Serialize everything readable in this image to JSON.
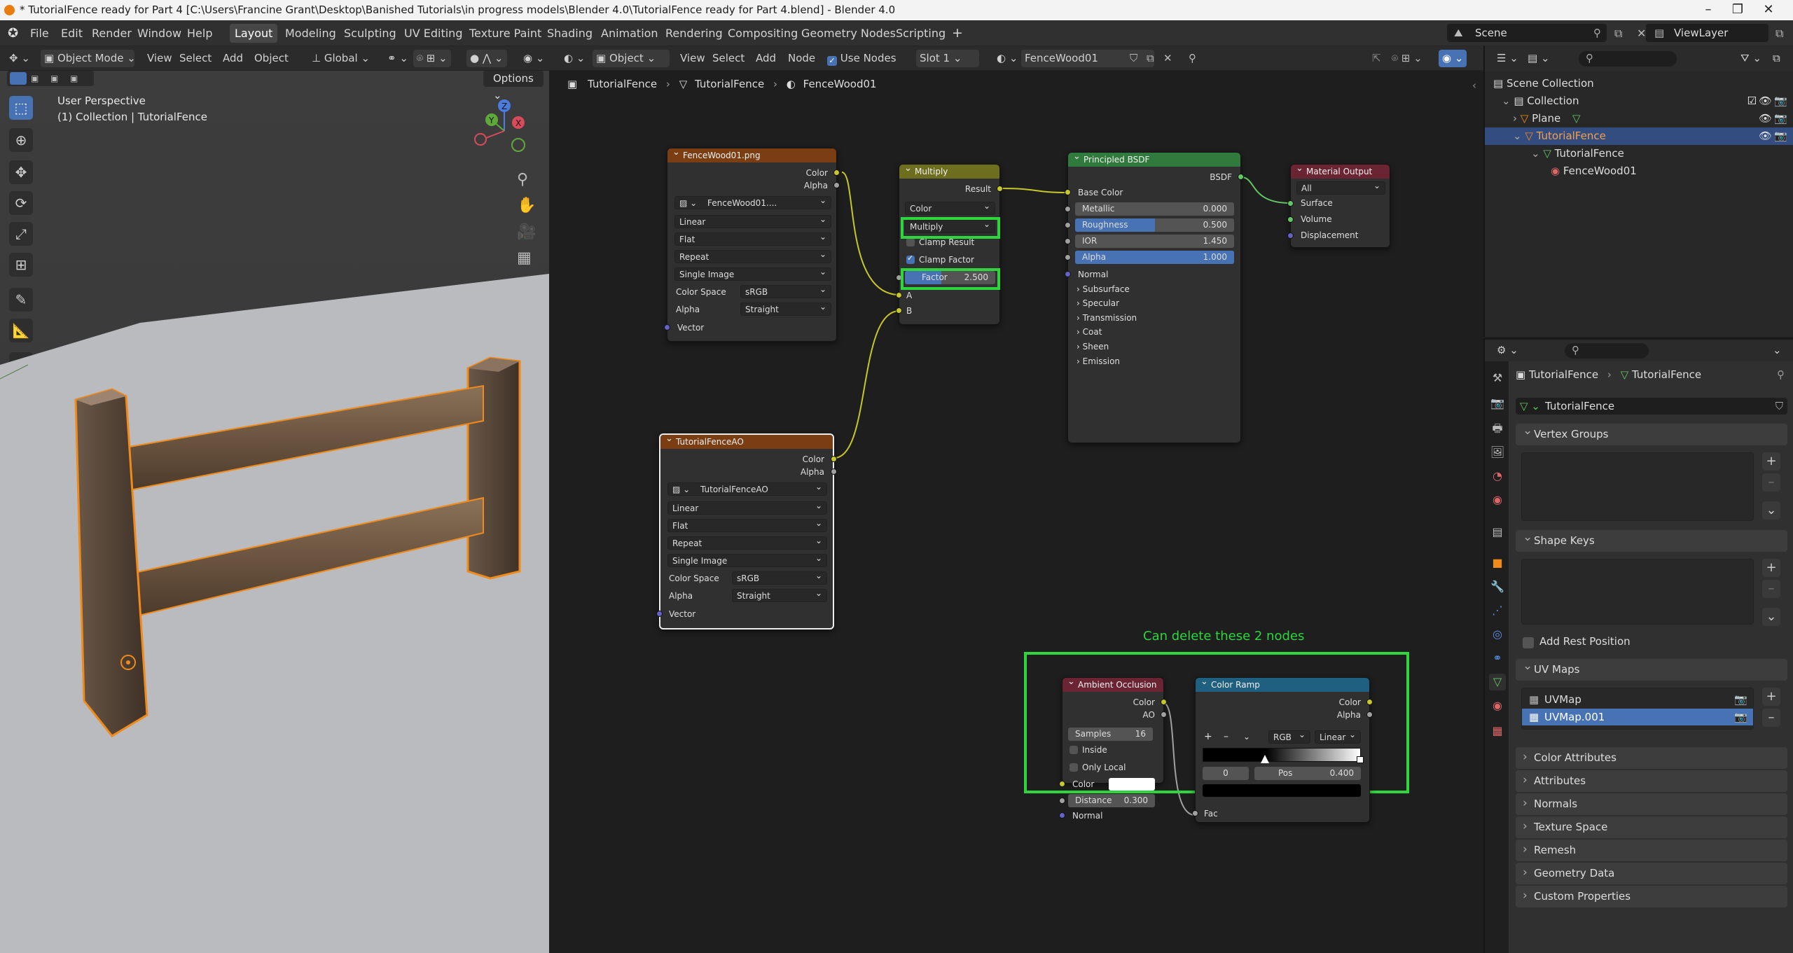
{
  "window": {
    "title": "* TutorialFence ready for Part 4 [C:\\Users\\Francine Grant\\Desktop\\Banished Tutorials\\in progress models\\Blender 4.0\\TutorialFence ready for Part 4.blend] - Blender 4.0"
  },
  "menu": [
    "File",
    "Edit",
    "Render",
    "Window",
    "Help"
  ],
  "workspaces": [
    "Layout",
    "Modeling",
    "Sculpting",
    "UV Editing",
    "Texture Paint",
    "Shading",
    "Animation",
    "Rendering",
    "Compositing",
    "Geometry Nodes",
    "Scripting"
  ],
  "active_workspace": "Layout",
  "scene": "Scene",
  "view_layer": "ViewLayer",
  "viewport": {
    "mode": "Object Mode",
    "menus": [
      "View",
      "Select",
      "Add",
      "Object"
    ],
    "orientation": "Global",
    "options": "Options",
    "overlay_line1": "User Perspective",
    "overlay_line2": "(1) Collection | TutorialFence",
    "gizmo": {
      "x": "X",
      "y": "Y",
      "z": "Z"
    }
  },
  "node_editor": {
    "type": "Object",
    "menus": [
      "View",
      "Select",
      "Add",
      "Node"
    ],
    "use_nodes": "Use Nodes",
    "slot": "Slot 1",
    "material": "FenceWood01",
    "breadcrumb": [
      "TutorialFence",
      "TutorialFence",
      "FenceWood01"
    ],
    "annotation": "Can delete these 2 nodes",
    "nodes": {
      "fence_tex": {
        "title": "FenceWood01.png",
        "out_color": "Color",
        "out_alpha": "Alpha",
        "image": "FenceWood01....",
        "interp": "Linear",
        "proj": "Flat",
        "ext": "Repeat",
        "source": "Single Image",
        "cs_label": "Color Space",
        "cs_value": "sRGB",
        "alpha_label": "Alpha",
        "alpha_value": "Straight",
        "in_vector": "Vector"
      },
      "ao_tex": {
        "title": "TutorialFenceAO",
        "out_color": "Color",
        "out_alpha": "Alpha",
        "image": "TutorialFenceAO",
        "interp": "Linear",
        "proj": "Flat",
        "ext": "Repeat",
        "source": "Single Image",
        "cs_label": "Color Space",
        "cs_value": "sRGB",
        "alpha_label": "Alpha",
        "alpha_value": "Straight",
        "in_vector": "Vector"
      },
      "multiply": {
        "title": "Multiply",
        "out": "Result",
        "data_type": "Color",
        "blend": "Multiply",
        "clamp_result": "Clamp Result",
        "clamp_factor": "Clamp Factor",
        "factor_label": "Factor",
        "factor_value": "2.500",
        "in_a": "A",
        "in_b": "B"
      },
      "bsdf": {
        "title": "Principled BSDF",
        "out": "BSDF",
        "base_color": "Base Color",
        "metallic_label": "Metallic",
        "metallic_value": "0.000",
        "metallic_fill": 0.0,
        "roughness_label": "Roughness",
        "roughness_value": "0.500",
        "roughness_fill": 0.5,
        "ior_label": "IOR",
        "ior_value": "1.450",
        "alpha_label": "Alpha",
        "alpha_value": "1.000",
        "alpha_fill": 1.0,
        "normal": "Normal",
        "sections": [
          "Subsurface",
          "Specular",
          "Transmission",
          "Coat",
          "Sheen",
          "Emission"
        ]
      },
      "output": {
        "title": "Material Output",
        "target": "All",
        "surface": "Surface",
        "volume": "Volume",
        "displacement": "Displacement"
      },
      "ao": {
        "title": "Ambient Occlusion",
        "out_color": "Color",
        "out_ao": "AO",
        "samples_label": "Samples",
        "samples_value": "16",
        "inside": "Inside",
        "only_local": "Only Local",
        "in_color": "Color",
        "distance_label": "Distance",
        "distance_value": "0.300",
        "in_normal": "Normal"
      },
      "ramp": {
        "title": "Color Ramp",
        "out_color": "Color",
        "out_alpha": "Alpha",
        "mode": "RGB",
        "interp": "Linear",
        "index": "0",
        "pos_label": "Pos",
        "pos_value": "0.400",
        "in_fac": "Fac"
      }
    }
  },
  "outliner": {
    "scene_collection": "Scene Collection",
    "items": [
      {
        "label": "Collection"
      },
      {
        "label": "Plane"
      },
      {
        "label": "TutorialFence"
      },
      {
        "label": "TutorialFence"
      },
      {
        "label": "FenceWood01"
      }
    ]
  },
  "properties": {
    "breadcrumb": [
      "TutorialFence",
      "TutorialFence"
    ],
    "mesh_name": "TutorialFence",
    "panels": {
      "vertex_groups": "Vertex Groups",
      "shape_keys": "Shape Keys",
      "add_rest_position": "Add Rest Position",
      "uv_maps": "UV Maps",
      "uv_items": [
        "UVMap",
        "UVMap.001"
      ],
      "closed": [
        "Color Attributes",
        "Attributes",
        "Normals",
        "Texture Space",
        "Remesh",
        "Geometry Data",
        "Custom Properties"
      ]
    }
  },
  "colors": {
    "accent": "#4772b3",
    "selection_orange": "#f08a1a",
    "highlight_green": "#2cd63c",
    "tex_header": "#7b3e13",
    "mix_header": "#6e6e1f",
    "shader_header": "#2f7a3c",
    "output_header": "#6b2431",
    "ramp_header": "#1f5f80"
  }
}
